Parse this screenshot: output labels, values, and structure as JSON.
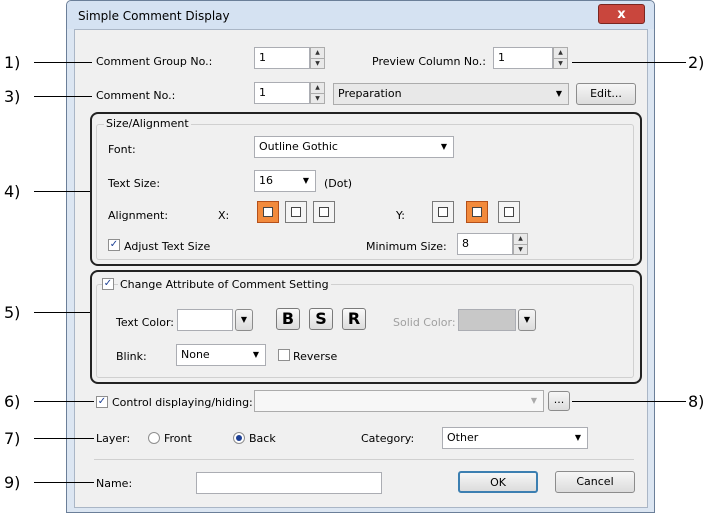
{
  "window": {
    "title": "Simple Comment Display",
    "close_glyph": "x"
  },
  "callouts": {
    "c1": "1)",
    "c2": "2)",
    "c3": "3)",
    "c4": "4)",
    "c5": "5)",
    "c6": "6)",
    "c7": "7)",
    "c8": "8)",
    "c9": "9)"
  },
  "comment_group": {
    "label": "Comment Group No.:",
    "value": "1"
  },
  "preview_column": {
    "label": "Preview Column No.:",
    "value": "1"
  },
  "comment_no": {
    "label": "Comment No.:",
    "value": "1",
    "comment_selected": "Preparation",
    "edit_label": "Edit..."
  },
  "size_alignment": {
    "group_label": "Size/Alignment",
    "font_label": "Font:",
    "font_value": "Outline Gothic",
    "text_size_label": "Text Size:",
    "text_size_value": "16",
    "text_size_unit": "(Dot)",
    "alignment_label": "Alignment:",
    "x_label": "X:",
    "y_label": "Y:",
    "x_selected": "left",
    "y_selected": "middle",
    "adjust_label": "Adjust Text Size",
    "adjust_checked": true,
    "min_size_label": "Minimum Size:",
    "min_size_value": "8"
  },
  "change_attr": {
    "group_label": "Change Attribute of Comment Setting",
    "checked": true,
    "text_color_label": "Text Color:",
    "bold_label": "B",
    "shadow_label": "S",
    "raised_label": "R",
    "solid_color_label": "Solid Color:",
    "blink_label": "Blink:",
    "blink_value": "None",
    "reverse_label": "Reverse",
    "reverse_checked": false
  },
  "control": {
    "label": "Control displaying/hiding:",
    "checked": true,
    "value": "",
    "browse_label": "..."
  },
  "layer": {
    "label": "Layer:",
    "front_label": "Front",
    "back_label": "Back",
    "selected": "Back"
  },
  "category": {
    "label": "Category:",
    "value": "Other"
  },
  "name": {
    "label": "Name:",
    "value": ""
  },
  "footer": {
    "ok_label": "OK",
    "cancel_label": "Cancel"
  },
  "colors": {
    "accent": "#f28a3c",
    "close": "#c9463d",
    "frame": "#dce6f2"
  }
}
